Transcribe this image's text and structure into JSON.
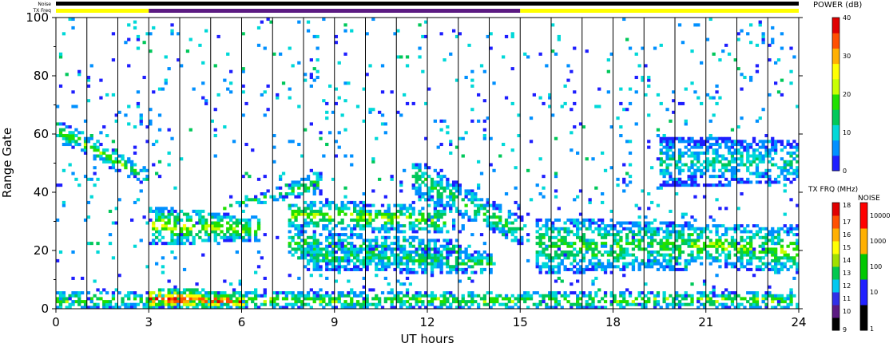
{
  "chart_data": {
    "type": "heatmap",
    "xlabel": "UT hours",
    "ylabel": "Range Gate",
    "xlim": [
      0,
      24
    ],
    "ylim": [
      0,
      100
    ],
    "xticks": [
      0,
      3,
      6,
      9,
      12,
      15,
      18,
      21,
      24
    ],
    "yticks": [
      0,
      20,
      40,
      60,
      80,
      100
    ],
    "top_bars": {
      "noise_label": "Noise",
      "txfreq_label": "TX Freq",
      "noise_color": "#000000",
      "txfreq_segments": [
        {
          "x0": 0,
          "x1": 3,
          "color": "#ffff00"
        },
        {
          "x0": 3,
          "x1": 15,
          "color": "#5b1a82"
        },
        {
          "x0": 15,
          "x1": 24,
          "color": "#ffff00"
        }
      ]
    },
    "power_scale": {
      "title": "POWER (dB)",
      "ticks": [
        0,
        10,
        20,
        30,
        40
      ],
      "range": [
        0,
        40
      ],
      "colors": [
        "#1e1eff",
        "#0090ff",
        "#00d8d8",
        "#00c85a",
        "#20e000",
        "#c8ff00",
        "#ffff00",
        "#ffb000",
        "#ff5000",
        "#e00000"
      ]
    },
    "txfreq_scale": {
      "title": "TX FRQ (MHz)",
      "ticks": [
        "9",
        "10",
        "11",
        "12",
        "13",
        "14",
        "15",
        "16",
        "17",
        "18"
      ],
      "colors": [
        "#000000",
        "#5b1a82",
        "#3030e8",
        "#00c8f0",
        "#00c850",
        "#a0e000",
        "#ffff00",
        "#ffb000",
        "#ff5000",
        "#e00000"
      ]
    },
    "noise_scale": {
      "title": "NOISE",
      "ticks": [
        "1",
        "10",
        "100",
        "1000",
        "10000"
      ],
      "colors": [
        "#000000",
        "#2020ff",
        "#00c800",
        "#ffb000",
        "#ff0000"
      ]
    },
    "echo_regions": [
      {
        "x0": 0.0,
        "x1": 3.0,
        "y0": 64,
        "y1": 58,
        "y2": 46,
        "y3": 42,
        "p": 14
      },
      {
        "x0": 3.0,
        "x1": 6.5,
        "y0": 34,
        "y1": 22,
        "y2": 30,
        "y3": 24,
        "p": 17
      },
      {
        "x0": 5.0,
        "x1": 8.5,
        "y0": 32,
        "y1": 34,
        "y2": 46,
        "y3": 40,
        "p": 14
      },
      {
        "x0": 7.5,
        "x1": 12.5,
        "y0": 36,
        "y1": 28,
        "y2": 34,
        "y3": 26,
        "p": 16
      },
      {
        "x0": 7.5,
        "x1": 13.0,
        "y0": 26,
        "y1": 18,
        "y2": 22,
        "y3": 14,
        "p": 14
      },
      {
        "x0": 8.0,
        "x1": 14.0,
        "y0": 22,
        "y1": 14,
        "y2": 18,
        "y3": 12,
        "p": 12
      },
      {
        "x0": 11.5,
        "x1": 15.0,
        "y0": 50,
        "y1": 40,
        "y2": 30,
        "y3": 22,
        "p": 12
      },
      {
        "x0": 15.5,
        "x1": 20.5,
        "y0": 30,
        "y1": 12,
        "y2": 28,
        "y3": 14,
        "p": 13
      },
      {
        "x0": 20.5,
        "x1": 24.0,
        "y0": 28,
        "y1": 16,
        "y2": 26,
        "y3": 12,
        "p": 15
      },
      {
        "x0": 19.5,
        "x1": 24.0,
        "y0": 58,
        "y1": 42,
        "y2": 56,
        "y3": 44,
        "p": 9
      },
      {
        "x0": 0.0,
        "x1": 24.0,
        "y0": 5,
        "y1": 0,
        "y2": 5,
        "y3": 0,
        "p": 15
      },
      {
        "x0": 3.0,
        "x1": 6.0,
        "y0": 6,
        "y1": 0,
        "y2": 4,
        "y3": 0,
        "p": 30
      }
    ]
  }
}
